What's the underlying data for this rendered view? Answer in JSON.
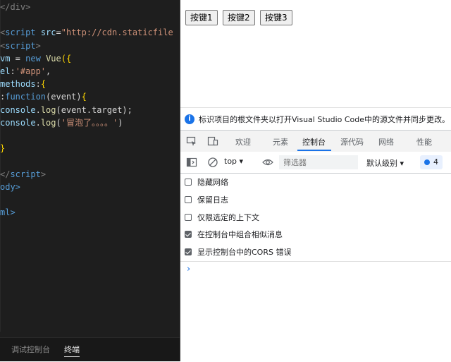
{
  "editor": {
    "lines": [
      {
        "segments": [
          {
            "t": "</div>",
            "c": "c-tag"
          }
        ]
      },
      {
        "segments": []
      },
      {
        "segments": [
          {
            "t": "<",
            "c": "c-tag"
          },
          {
            "t": "script",
            "c": "c-tagname"
          },
          {
            "t": " ",
            "c": "c-plain"
          },
          {
            "t": "src",
            "c": "c-attr"
          },
          {
            "t": "=",
            "c": "c-plain"
          },
          {
            "t": "\"http://cdn.staticfile",
            "c": "c-str"
          }
        ]
      },
      {
        "segments": [
          {
            "t": "<",
            "c": "c-tag"
          },
          {
            "t": "script",
            "c": "c-tagname"
          },
          {
            "t": ">",
            "c": "c-tag"
          }
        ]
      },
      {
        "segments": [
          {
            "t": "vm",
            "c": "c-prop"
          },
          {
            "t": " = ",
            "c": "c-plain"
          },
          {
            "t": "new",
            "c": "c-kw"
          },
          {
            "t": " ",
            "c": "c-plain"
          },
          {
            "t": "Vue",
            "c": "c-fn"
          },
          {
            "t": "({",
            "c": "c-brace"
          }
        ]
      },
      {
        "segments": [
          {
            "t": "el",
            "c": "c-prop"
          },
          {
            "t": ":",
            "c": "c-plain"
          },
          {
            "t": "'#app'",
            "c": "c-str"
          },
          {
            "t": ",",
            "c": "c-plain"
          }
        ]
      },
      {
        "segments": [
          {
            "t": "methods",
            "c": "c-prop"
          },
          {
            "t": ":",
            "c": "c-plain"
          },
          {
            "t": "{",
            "c": "c-brace"
          }
        ]
      },
      {
        "segments": [
          {
            "t": ":",
            "c": "c-plain"
          },
          {
            "t": "function",
            "c": "c-kw"
          },
          {
            "t": "(event)",
            "c": "c-plain"
          },
          {
            "t": "{",
            "c": "c-brace"
          }
        ]
      },
      {
        "segments": [
          {
            "t": "console",
            "c": "c-prop"
          },
          {
            "t": ".",
            "c": "c-plain"
          },
          {
            "t": "log",
            "c": "c-fn"
          },
          {
            "t": "(event.target);",
            "c": "c-plain"
          }
        ]
      },
      {
        "segments": [
          {
            "t": "console",
            "c": "c-prop"
          },
          {
            "t": ".",
            "c": "c-plain"
          },
          {
            "t": "log",
            "c": "c-fn"
          },
          {
            "t": "(",
            "c": "c-plain"
          },
          {
            "t": "'冒泡了。。。。'",
            "c": "c-str"
          },
          {
            "t": ")",
            "c": "c-plain"
          }
        ]
      },
      {
        "segments": []
      },
      {
        "segments": [
          {
            "t": "}",
            "c": "c-brace"
          }
        ]
      },
      {
        "segments": []
      },
      {
        "segments": [
          {
            "t": "</",
            "c": "c-tag"
          },
          {
            "t": "script",
            "c": "c-tagname"
          },
          {
            "t": ">",
            "c": "c-tag"
          }
        ]
      },
      {
        "segments": [
          {
            "t": "ody>",
            "c": "c-tagname"
          }
        ]
      },
      {
        "segments": []
      },
      {
        "segments": [
          {
            "t": "ml>",
            "c": "c-tagname"
          }
        ]
      }
    ],
    "bottom_tabs": [
      "调试控制台",
      "终端"
    ]
  },
  "page": {
    "buttons": [
      "按键1",
      "按键2",
      "按键3"
    ]
  },
  "info_bar": {
    "text": "标识项目的根文件夹以打开Visual Studio Code中的源文件并同步更改。"
  },
  "devtools": {
    "tabs": [
      "欢迎",
      "元素",
      "控制台",
      "源代码",
      "网络",
      "性能"
    ],
    "active_tab": "控制台"
  },
  "console_toolbar": {
    "context": "top",
    "filter_placeholder": "筛选器",
    "level": "默认级别",
    "issues_count": "4"
  },
  "settings": [
    {
      "label": "隐藏网络",
      "checked": false
    },
    {
      "label": "保留日志",
      "checked": false
    },
    {
      "label": "仅限选定的上下文",
      "checked": false
    },
    {
      "label": "在控制台中组合相似消息",
      "checked": true
    },
    {
      "label": "显示控制台中的CORS 错误",
      "checked": true
    }
  ],
  "console": {
    "prompt": "›"
  },
  "colors": {
    "editor_bg": "#1e1e1e",
    "accent": "#1a73e8"
  }
}
